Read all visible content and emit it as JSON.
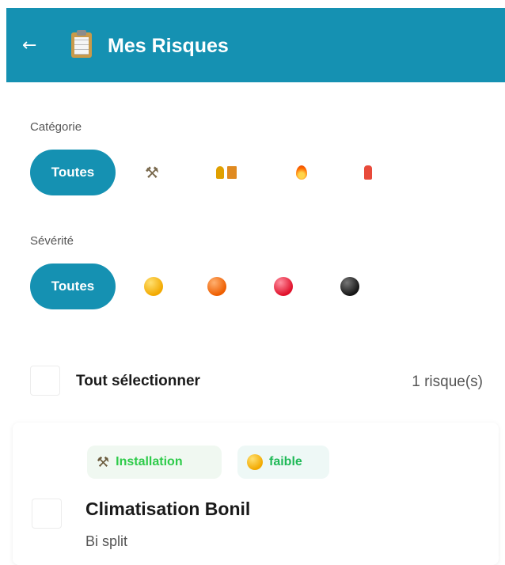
{
  "header": {
    "back_glyph": "←",
    "title": "Mes Risques",
    "title_icon": "clipboard-icon",
    "background_color": "#1591b2"
  },
  "category_filter": {
    "label": "Catégorie",
    "options": [
      {
        "label": "Toutes",
        "selected": true
      },
      {
        "icon": "hammer-wrench-icon",
        "glyph": "⚒",
        "selected": false
      },
      {
        "icon": "emergency-exit-icon",
        "glyph": "🏃🚪",
        "selected": false
      },
      {
        "icon": "fire-icon",
        "glyph": "🔥",
        "selected": false
      },
      {
        "icon": "fire-extinguisher-icon",
        "glyph": "🧯",
        "selected": false
      }
    ]
  },
  "severity_filter": {
    "label": "Sévérité",
    "options": [
      {
        "label": "Toutes",
        "selected": true
      },
      {
        "icon": "yellow-circle-icon",
        "color": "#f2a900",
        "selected": false
      },
      {
        "icon": "orange-circle-icon",
        "color": "#ee5e00",
        "selected": false
      },
      {
        "icon": "red-circle-icon",
        "color": "#e0102a",
        "selected": false
      },
      {
        "icon": "black-circle-icon",
        "color": "#151515",
        "selected": false
      }
    ]
  },
  "selection": {
    "select_all_label": "Tout sélectionner",
    "count_text": "1 risque(s)",
    "checked": false
  },
  "risks": [
    {
      "category_label": "Installation",
      "category_icon": "hammer-wrench-icon",
      "severity_label": "faible",
      "severity_icon": "yellow-circle-icon",
      "title": "Climatisation Bonil",
      "subtitle": "Bi split",
      "checked": false
    }
  ]
}
